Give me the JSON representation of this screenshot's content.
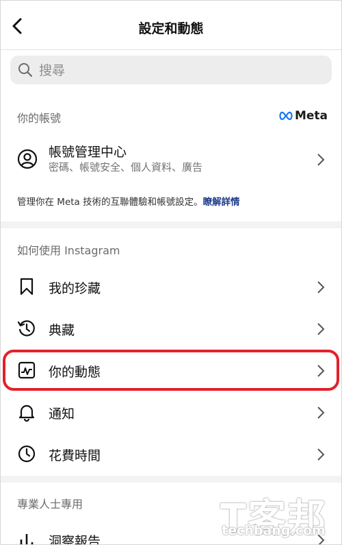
{
  "header": {
    "title": "設定和動態"
  },
  "search": {
    "placeholder": "搜尋"
  },
  "account_section": {
    "heading": "你的帳號",
    "brand": "Meta",
    "account_center": {
      "title": "帳號管理中心",
      "subtitle": "密碼、帳號安全、個人資料、廣告"
    },
    "footnote": "管理你在 Meta 技術的互聯體驗和帳號設定。",
    "footnote_link": "瞭解詳情"
  },
  "usage_section": {
    "heading": "如何使用 Instagram",
    "items": [
      {
        "label": "我的珍藏",
        "icon": "bookmark-icon"
      },
      {
        "label": "典藏",
        "icon": "archive-history-icon"
      },
      {
        "label": "你的動態",
        "icon": "activity-icon",
        "highlighted": true
      },
      {
        "label": "通知",
        "icon": "bell-icon"
      },
      {
        "label": "花費時間",
        "icon": "clock-icon"
      }
    ]
  },
  "professional_section": {
    "heading": "專業人士專用",
    "items": [
      {
        "label": "洞察報告",
        "icon": "bar-chart-icon"
      }
    ]
  },
  "watermark": {
    "brand": "T客邦",
    "url": "techbang.com"
  },
  "colors": {
    "highlight": "#e3202a",
    "link": "#1f3c8a"
  }
}
